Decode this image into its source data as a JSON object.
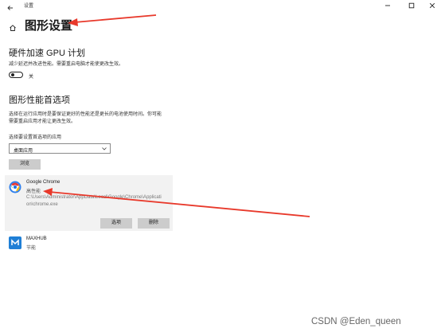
{
  "window": {
    "app_title": "设置",
    "controls": {
      "minimize": "minimize-icon",
      "maximize": "maximize-icon",
      "close": "close-icon"
    }
  },
  "page": {
    "title": "图形设置",
    "home_icon": "home-icon"
  },
  "gpu_section": {
    "title": "硬件加速 GPU 计划",
    "description": "减少延迟并改进性能。需要重启电脑才能使更改生效。",
    "toggle_label": "关",
    "toggle_on": false
  },
  "pref_section": {
    "title": "图形性能首选项",
    "description_line1": "选择在运行应用时是要保证更好的性能还是更长的电池使用时间。你可能",
    "description_line2": "需要重启应用才能让更改生效。",
    "select_label": "选择要设置首选项的应用",
    "dropdown_value": "桌面应用",
    "browse_label": "浏览"
  },
  "apps": [
    {
      "name": "Google Chrome",
      "preference": "高性能",
      "path": "C:\\Users\\Administrator\\AppData\\Local\\Google\\Chrome\\Application\\chrome.exe",
      "icon": "chrome-icon",
      "options_label": "选项",
      "remove_label": "删除"
    },
    {
      "name": "MAXHUB",
      "preference": "节能",
      "icon": "maxhub-icon"
    }
  ],
  "watermark": "CSDN @Eden_queen",
  "colors": {
    "annotation_arrow": "#e8392b",
    "card_bg": "#f2f2f2",
    "button_bg": "#cccccc",
    "maxhub_brand": "#1f7fd6"
  }
}
